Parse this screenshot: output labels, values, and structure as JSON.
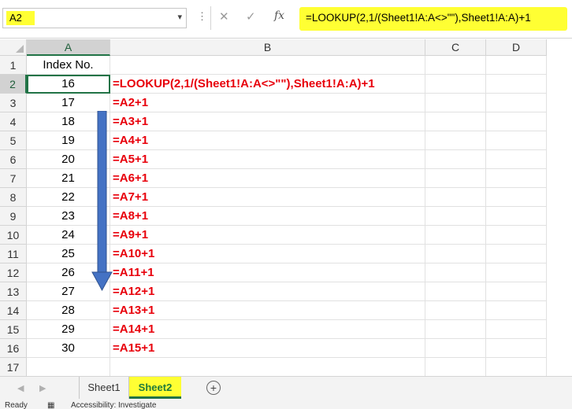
{
  "formula_bar": {
    "name_box": "A2",
    "formula": "=LOOKUP(2,1/(Sheet1!A:A<>\"\"),Sheet1!A:A)+1",
    "fx_label": "fx",
    "cancel_icon": "close-icon",
    "enter_icon": "check-icon"
  },
  "columns": [
    "A",
    "B",
    "C",
    "D"
  ],
  "rows": [
    {
      "num": "1",
      "a": "Index No.",
      "b": ""
    },
    {
      "num": "2",
      "a": "16",
      "b": "=LOOKUP(2,1/(Sheet1!A:A<>\"\"),Sheet1!A:A)+1"
    },
    {
      "num": "3",
      "a": "17",
      "b": "=A2+1"
    },
    {
      "num": "4",
      "a": "18",
      "b": "=A3+1"
    },
    {
      "num": "5",
      "a": "19",
      "b": "=A4+1"
    },
    {
      "num": "6",
      "a": "20",
      "b": "=A5+1"
    },
    {
      "num": "7",
      "a": "21",
      "b": "=A6+1"
    },
    {
      "num": "8",
      "a": "22",
      "b": "=A7+1"
    },
    {
      "num": "9",
      "a": "23",
      "b": "=A8+1"
    },
    {
      "num": "10",
      "a": "24",
      "b": "=A9+1"
    },
    {
      "num": "11",
      "a": "25",
      "b": "=A10+1"
    },
    {
      "num": "12",
      "a": "26",
      "b": "=A11+1"
    },
    {
      "num": "13",
      "a": "27",
      "b": "=A12+1"
    },
    {
      "num": "14",
      "a": "28",
      "b": "=A13+1"
    },
    {
      "num": "15",
      "a": "29",
      "b": "=A14+1"
    },
    {
      "num": "16",
      "a": "30",
      "b": "=A15+1"
    },
    {
      "num": "17",
      "a": "",
      "b": ""
    }
  ],
  "sheets": {
    "tab1": "Sheet1",
    "tab2": "Sheet2"
  },
  "status": {
    "ready": "Ready",
    "accessibility": "Accessibility: Investigate"
  },
  "colors": {
    "highlight": "#ffff33",
    "formula_text": "#e8000b",
    "arrow": "#4472c4",
    "excel_green": "#217346"
  }
}
